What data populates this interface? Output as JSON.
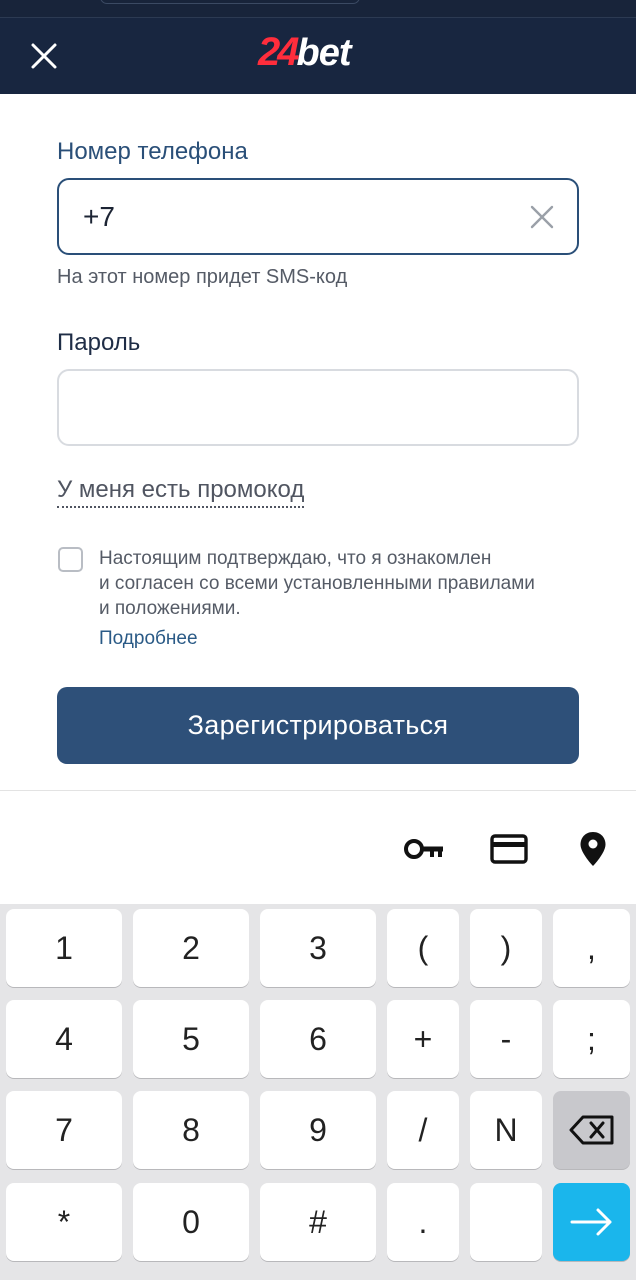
{
  "header": {
    "logo_number": "24",
    "logo_word": "bet"
  },
  "form": {
    "phone_label": "Номер телефона",
    "phone_value": "+7",
    "phone_hint": "На этот номер придет SMS-код",
    "password_label": "Пароль",
    "password_value": "",
    "promo_link": "У меня есть промокод",
    "terms_line1": "Настоящим подтверждаю, что я ознакомлен",
    "terms_line2": "и согласен со всеми установленными правилами",
    "terms_line3": "и положениями.",
    "terms_checked": false,
    "more_link": "Подробнее",
    "register_button": "Зарегистрироваться"
  },
  "keyboard": {
    "toolbar_icons": [
      "key-icon",
      "credit-card-icon",
      "location-pin-icon"
    ],
    "rows": [
      [
        "1",
        "2",
        "3",
        "(",
        ")",
        ","
      ],
      [
        "4",
        "5",
        "6",
        "+",
        "-",
        ";"
      ],
      [
        "7",
        "8",
        "9",
        "/",
        "N",
        "backspace"
      ],
      [
        "*",
        "0",
        "#",
        ".",
        "",
        "enter"
      ]
    ]
  },
  "colors": {
    "header_bg": "#182640",
    "logo_red": "#ff2d3c",
    "accent": "#2a4f78",
    "button_bg": "#2e5079",
    "enter_key": "#1ab6ec"
  }
}
